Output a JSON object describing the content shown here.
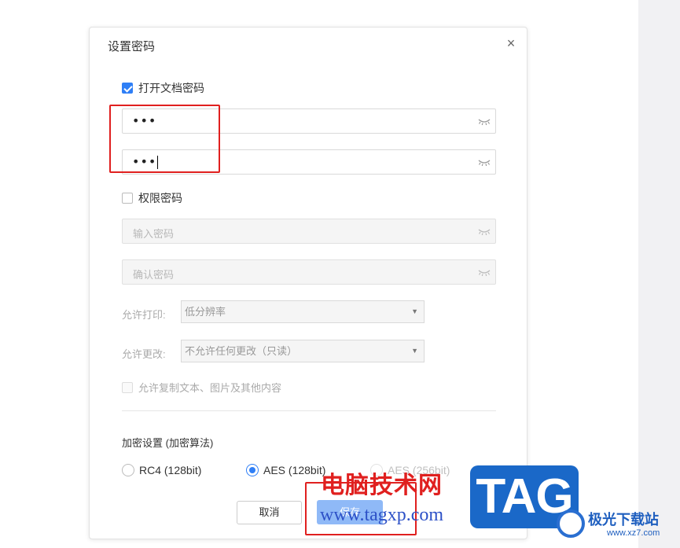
{
  "dialog": {
    "title": "设置密码",
    "close": "×"
  },
  "open_password": {
    "checkbox_label": "打开文档密码",
    "checked": true,
    "password_value": "•••",
    "confirm_value": "•••"
  },
  "permission_password": {
    "checkbox_label": "权限密码",
    "checked": false,
    "password_placeholder": "输入密码",
    "confirm_placeholder": "确认密码"
  },
  "permissions": {
    "print_label": "允许打印:",
    "print_value": "低分辨率",
    "modify_label": "允许更改:",
    "modify_value": "不允许任何更改（只读）",
    "copy_label": "允许复制文本、图片及其他内容"
  },
  "encryption": {
    "section_title": "加密设置 (加密算法)",
    "options": [
      {
        "label": "RC4 (128bit)",
        "selected": false
      },
      {
        "label": "AES (128bit)",
        "selected": true
      },
      {
        "label": "AES (256bit)",
        "selected": false
      }
    ]
  },
  "buttons": {
    "cancel": "取消",
    "save": "保存"
  },
  "watermark": {
    "site_name": "电脑技术网",
    "url": "www.tagxp.com",
    "tag": "TAG",
    "logo_text": "极光下载站",
    "logo_url": "www.xz7.com"
  },
  "colors": {
    "accent": "#2f7ff6",
    "highlight_red": "#e0201f"
  }
}
